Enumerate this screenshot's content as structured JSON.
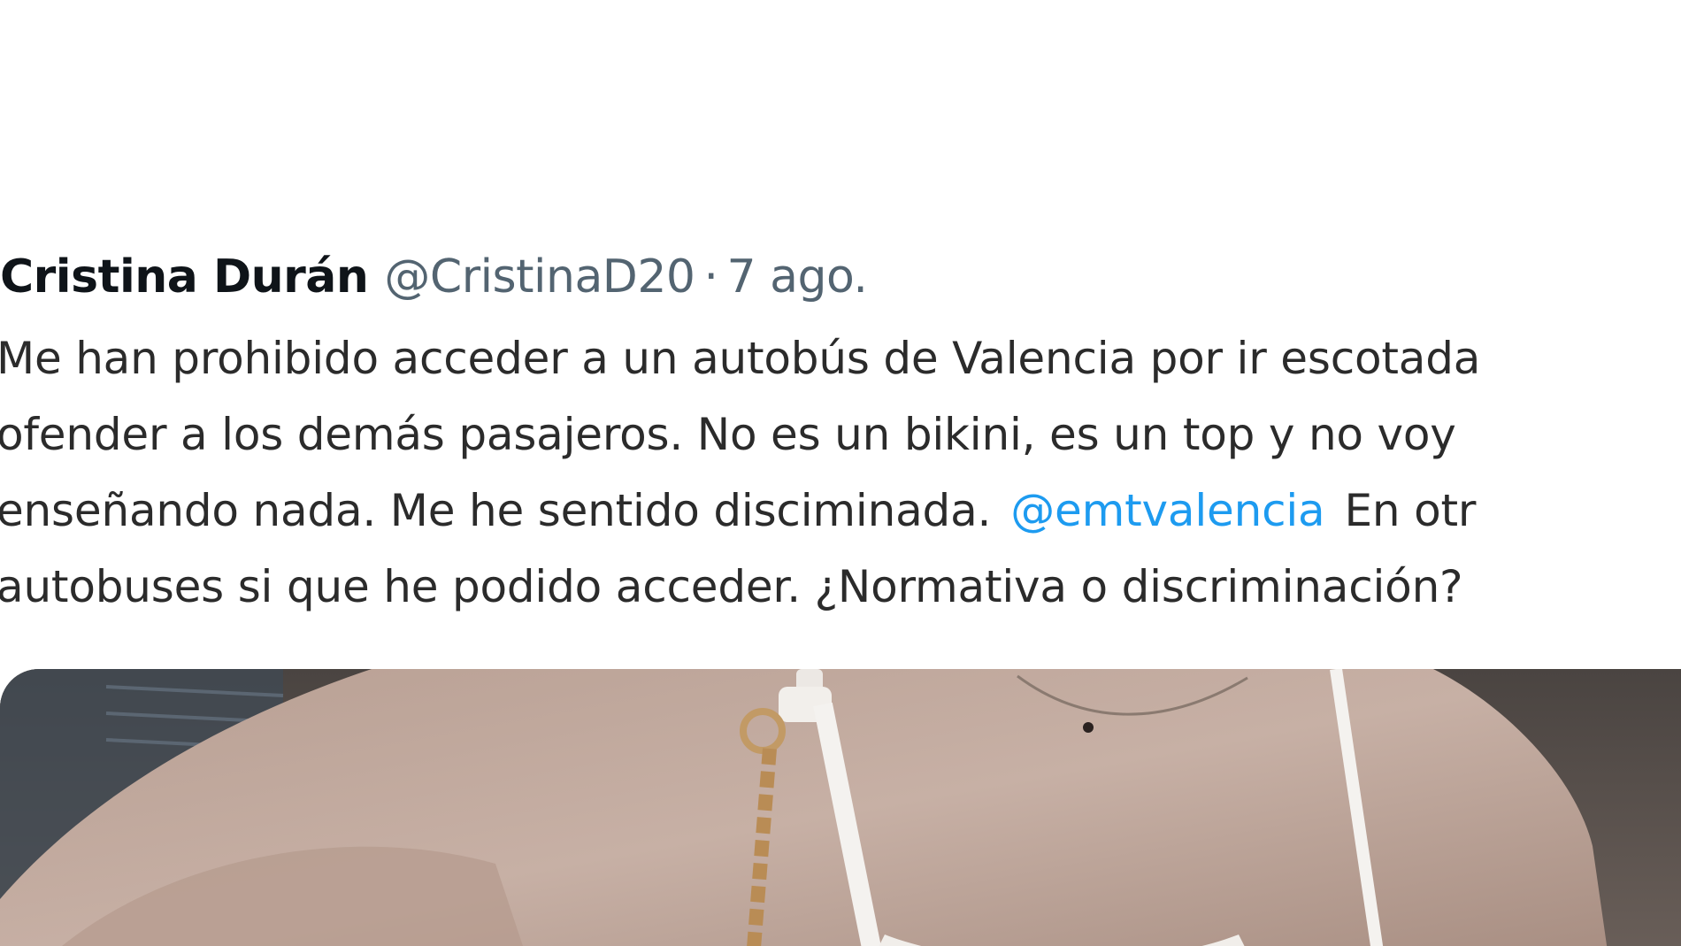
{
  "tweet": {
    "author_name": "Cristina Durán",
    "author_handle": "@CristinaD20",
    "separator": "·",
    "date": "7 ago.",
    "text_lines": [
      {
        "before": "Me han prohibido acceder a un autobús de Valencia por ir escotada"
      },
      {
        "before": "ofender a los demás pasajeros. No es un bikini, es un top y no voy"
      },
      {
        "before": "enseñando nada. Me he sentido disciminada.",
        "mention": "@emtvalencia",
        "after": "En otr"
      },
      {
        "before": "autobuses si que he podido acceder. ¿Normativa o discriminación?"
      }
    ],
    "media": {
      "type": "photo"
    }
  },
  "colors": {
    "text_primary": "#0f1419",
    "text_secondary": "#536471",
    "link": "#1d9bf0",
    "background": "#ffffff"
  }
}
